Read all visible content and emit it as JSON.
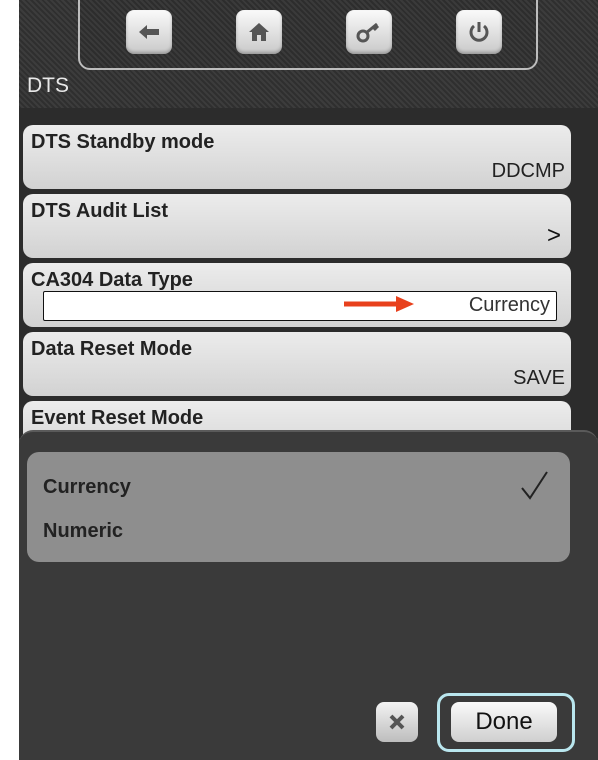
{
  "header": {
    "title": "DTS",
    "nav": [
      {
        "icon": "back-arrow-icon"
      },
      {
        "icon": "home-icon"
      },
      {
        "icon": "key-icon"
      },
      {
        "icon": "power-icon"
      }
    ]
  },
  "settings": [
    {
      "label": "DTS Standby mode",
      "value": "DDCMP"
    },
    {
      "label": "DTS Audit List",
      "value": ">"
    },
    {
      "label": "CA304 Data Type",
      "value": "Currency"
    },
    {
      "label": "Data Reset Mode",
      "value": "SAVE"
    },
    {
      "label": "Event Reset Mode",
      "value": ""
    }
  ],
  "picker": {
    "options": [
      {
        "label": "Currency",
        "selected": true
      },
      {
        "label": "Numeric",
        "selected": false
      }
    ],
    "cancel_icon": "close-icon",
    "done_label": "Done"
  },
  "colors": {
    "annotation_arrow": "#e8401c",
    "done_highlight": "#b9e6ee"
  }
}
